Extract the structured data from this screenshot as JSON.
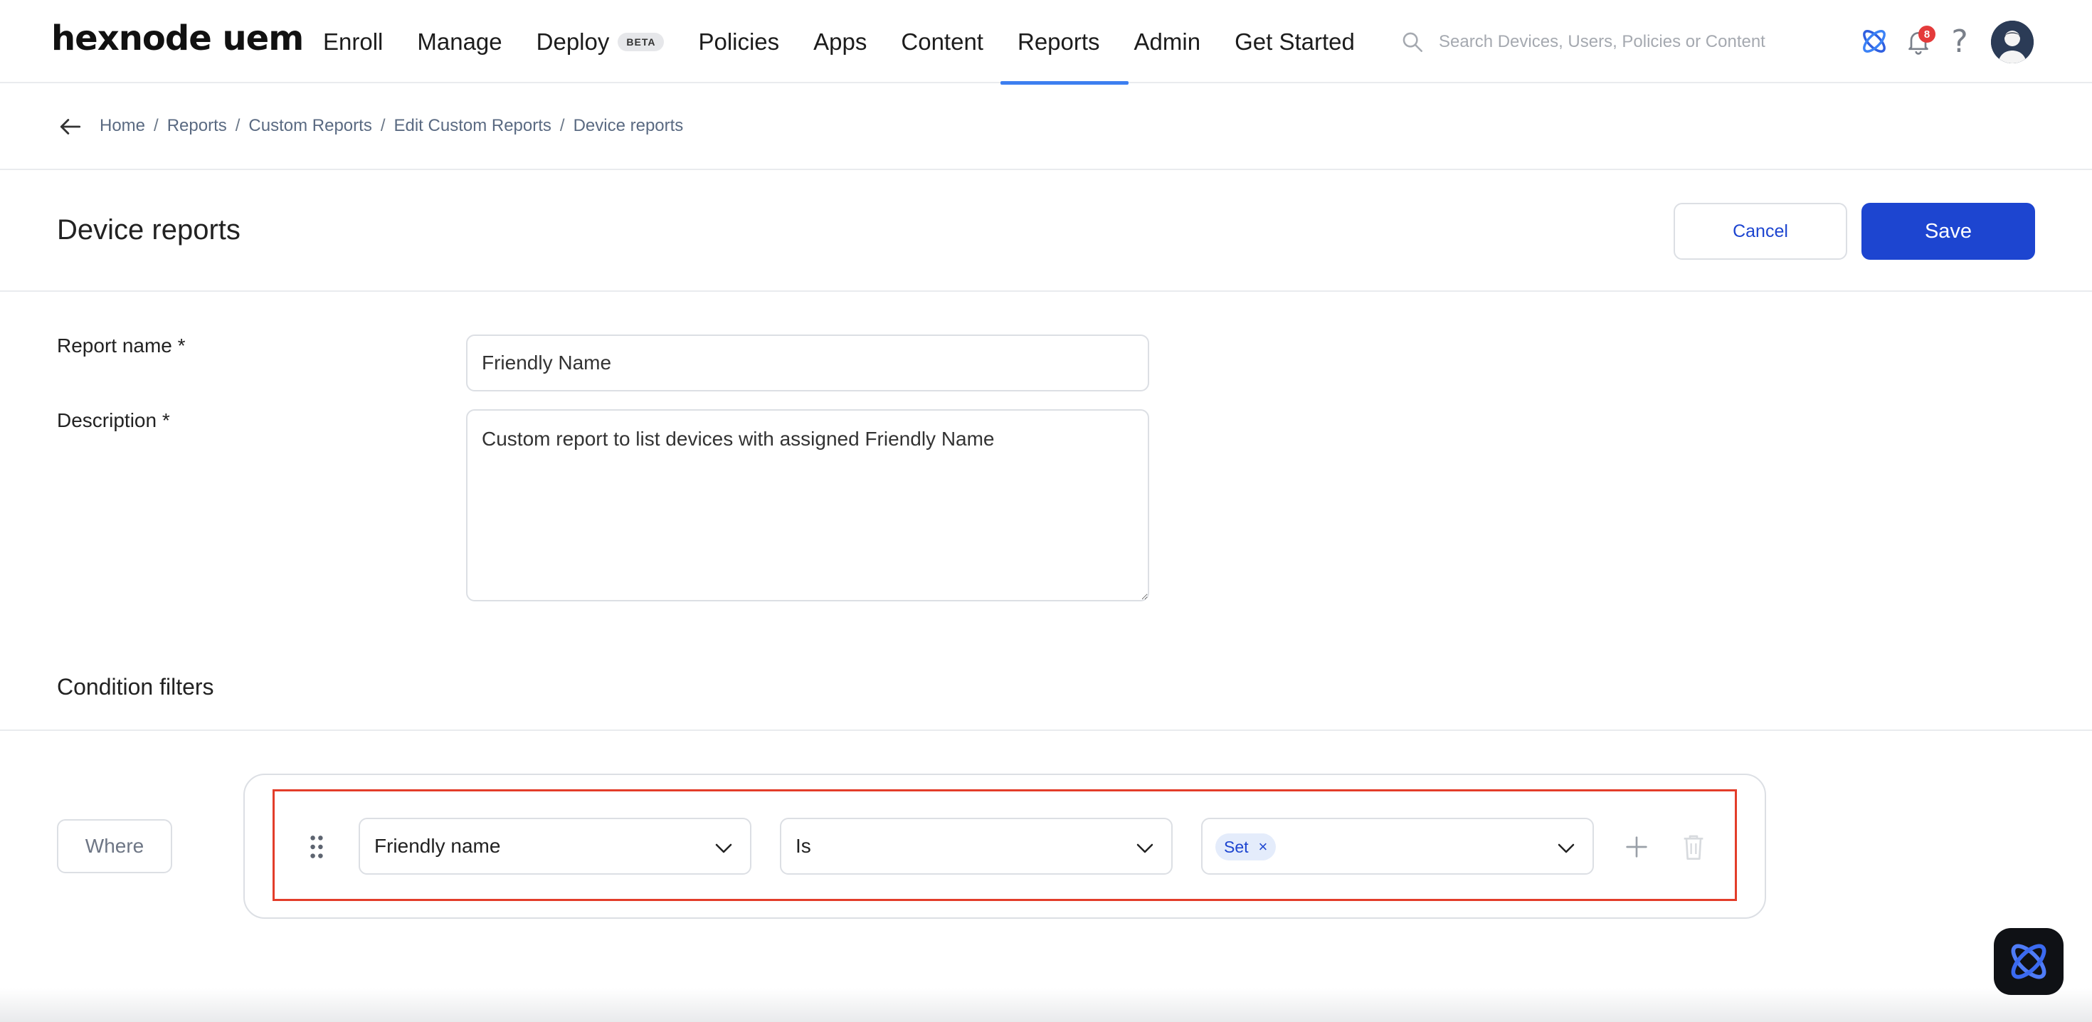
{
  "app": {
    "logo": "hexnode uem"
  },
  "nav": {
    "items": [
      {
        "label": "Enroll"
      },
      {
        "label": "Manage"
      },
      {
        "label": "Deploy",
        "badge": "BETA"
      },
      {
        "label": "Policies"
      },
      {
        "label": "Apps"
      },
      {
        "label": "Content"
      },
      {
        "label": "Reports",
        "active": true
      },
      {
        "label": "Admin"
      },
      {
        "label": "Get Started"
      }
    ],
    "search_placeholder": "Search Devices, Users, Policies or Content",
    "notification_count": "8"
  },
  "breadcrumb": [
    "Home",
    "Reports",
    "Custom Reports",
    "Edit Custom Reports",
    "Device reports"
  ],
  "header": {
    "title": "Device reports",
    "cancel_label": "Cancel",
    "save_label": "Save"
  },
  "form": {
    "report_name_label": "Report name *",
    "report_name_value": "Friendly Name",
    "description_label": "Description *",
    "description_value": "Custom report to list devices with assigned Friendly Name"
  },
  "conditions": {
    "section_title": "Condition filters",
    "where_label": "Where",
    "rows": [
      {
        "field": "Friendly name",
        "operator": "Is",
        "values": [
          "Set"
        ]
      }
    ]
  },
  "colors": {
    "primary": "#1d45d0",
    "nav_active_underline": "#3d7ff0",
    "highlight_border": "#e33d2a",
    "badge": "#e43b3b"
  }
}
